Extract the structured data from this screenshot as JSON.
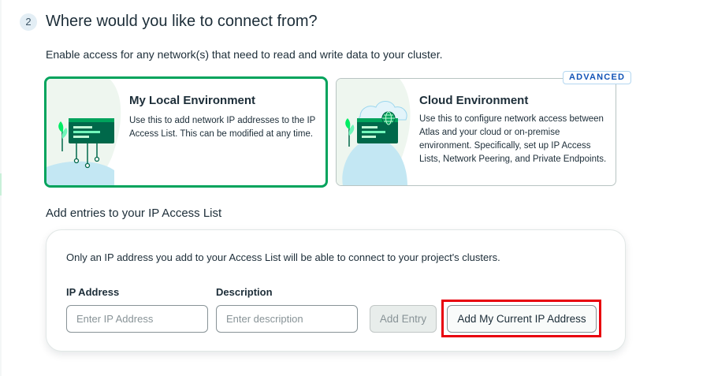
{
  "step": {
    "number": "2",
    "title": "Where would you like to connect from?"
  },
  "subtitle": "Enable access for any network(s) that need to read and write data to your cluster.",
  "options": {
    "local": {
      "title": "My Local Environment",
      "description": "Use this to add network IP addresses to the IP Access List. This can be modified at any time.",
      "selected": true
    },
    "cloud": {
      "title": "Cloud Environment",
      "description": "Use this to configure network access between Atlas and your cloud or on-premise environment. Specifically, set up IP Access Lists, Network Peering, and Private Endpoints.",
      "badge": "ADVANCED"
    }
  },
  "access_list": {
    "section_title": "Add entries to your IP Access List",
    "note": "Only an IP address you add to your Access List will be able to connect to your project's clusters.",
    "ip_label": "IP Address",
    "ip_placeholder": "Enter IP Address",
    "ip_value": "",
    "description_label": "Description",
    "description_placeholder": "Enter description",
    "description_value": "",
    "add_entry_label": "Add Entry",
    "add_current_ip_label": "Add My Current IP Address"
  },
  "colors": {
    "selected_border": "#00a35c",
    "badge_text": "#1254b7",
    "highlight": "#e8000d"
  }
}
